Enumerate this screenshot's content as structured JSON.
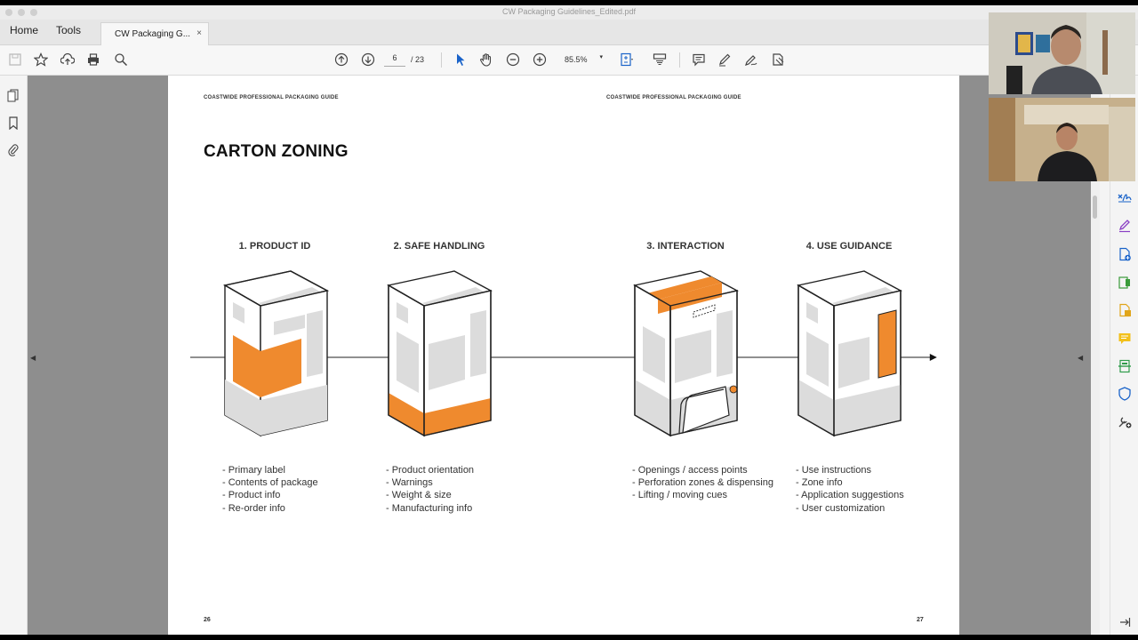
{
  "window": {
    "title": "CW Packaging Guidelines_Edited.pdf"
  },
  "tabs": {
    "home": "Home",
    "tools": "Tools",
    "document": "CW Packaging G...",
    "close": "×"
  },
  "toolbar": {
    "page_current": "6",
    "page_total": "/ 23",
    "zoom": "85.5%",
    "zoom_caret": "▾",
    "icons": [
      "save-icon",
      "star-icon",
      "upload-icon",
      "print-icon",
      "search-icon",
      "prev-page-icon",
      "next-page-icon",
      "select-cursor-icon",
      "hand-icon",
      "zoom-out-icon",
      "zoom-in-icon",
      "fit-page-icon",
      "scroll-mode-icon",
      "comment-icon",
      "highlight-icon",
      "sign-icon",
      "stamp-icon"
    ]
  },
  "left_panel": {
    "icons": [
      "pages-icon",
      "bookmark-icon",
      "attachment-icon"
    ]
  },
  "right_panel": {
    "icons": [
      "fill-sign-icon",
      "edit-pdf-icon",
      "create-pdf-icon",
      "export-pdf-icon",
      "organize-icon",
      "comment-icon",
      "scan-icon",
      "protect-icon",
      "more-tools-icon",
      "collapse-icon"
    ]
  },
  "document": {
    "running_header_left": "COASTWIDE PROFESSIONAL PACKAGING GUIDE",
    "running_header_right": "COASTWIDE PROFESSIONAL PACKAGING GUIDE",
    "heading": "CARTON ZONING",
    "page_left": "26",
    "page_right": "27",
    "zones": [
      {
        "title": "1. PRODUCT ID",
        "items": [
          "- Primary label",
          "- Contents of package",
          "- Product info",
          "- Re-order info"
        ]
      },
      {
        "title": "2. SAFE HANDLING",
        "items": [
          "- Product orientation",
          "- Warnings",
          "- Weight & size",
          "- Manufacturing info"
        ]
      },
      {
        "title": "3. INTERACTION",
        "items": [
          "- Openings / access points",
          "- Perforation zones & dispensing",
          "- Lifting / moving cues"
        ]
      },
      {
        "title": "4. USE GUIDANCE",
        "items": [
          "- Use instructions",
          "- Zone info",
          "- Application suggestions",
          "- User customization"
        ]
      }
    ]
  },
  "colors": {
    "accent": "#ef8a2e",
    "box_fill": "#ffffff",
    "panel_gray": "#d4d4d4",
    "outline": "#222222"
  }
}
